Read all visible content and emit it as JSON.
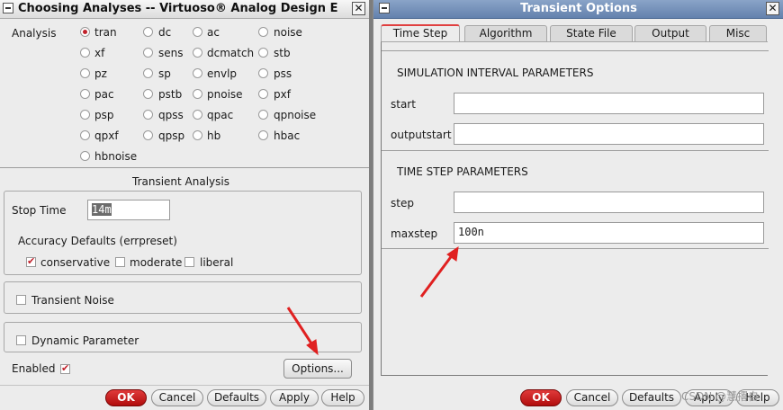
{
  "left_window": {
    "title": "Choosing Analyses -- Virtuoso® Analog Design E",
    "analysis_label": "Analysis",
    "analyses": [
      {
        "label": "tran",
        "selected": true
      },
      {
        "label": "dc",
        "selected": false
      },
      {
        "label": "ac",
        "selected": false
      },
      {
        "label": "noise",
        "selected": false
      },
      {
        "label": "xf",
        "selected": false
      },
      {
        "label": "sens",
        "selected": false
      },
      {
        "label": "dcmatch",
        "selected": false
      },
      {
        "label": "stb",
        "selected": false
      },
      {
        "label": "pz",
        "selected": false
      },
      {
        "label": "sp",
        "selected": false
      },
      {
        "label": "envlp",
        "selected": false
      },
      {
        "label": "pss",
        "selected": false
      },
      {
        "label": "pac",
        "selected": false
      },
      {
        "label": "pstb",
        "selected": false
      },
      {
        "label": "pnoise",
        "selected": false
      },
      {
        "label": "pxf",
        "selected": false
      },
      {
        "label": "psp",
        "selected": false
      },
      {
        "label": "qpss",
        "selected": false
      },
      {
        "label": "qpac",
        "selected": false
      },
      {
        "label": "qpnoise",
        "selected": false
      },
      {
        "label": "qpxf",
        "selected": false
      },
      {
        "label": "qpsp",
        "selected": false
      },
      {
        "label": "hb",
        "selected": false
      },
      {
        "label": "hbac",
        "selected": false
      },
      {
        "label": "hbnoise",
        "selected": false
      }
    ],
    "section_title": "Transient Analysis",
    "stop_time_label": "Stop Time",
    "stop_time_value": "14m",
    "accuracy_label": "Accuracy Defaults (errpreset)",
    "accuracy_options": [
      {
        "label": "conservative",
        "checked": true
      },
      {
        "label": "moderate",
        "checked": false
      },
      {
        "label": "liberal",
        "checked": false
      }
    ],
    "transient_noise_label": "Transient Noise",
    "dynamic_parameter_label": "Dynamic Parameter",
    "enabled_label": "Enabled",
    "enabled_checked": true,
    "options_button": "Options...",
    "buttons": {
      "ok": "OK",
      "cancel": "Cancel",
      "defaults": "Defaults",
      "apply": "Apply",
      "help": "Help"
    }
  },
  "right_window": {
    "title": "Transient Options",
    "tabs": [
      "Time Step",
      "Algorithm",
      "State File",
      "Output",
      "Misc"
    ],
    "active_tab": "Time Step",
    "sim_interval_heading": "SIMULATION INTERVAL PARAMETERS",
    "start_label": "start",
    "start_value": "",
    "outputstart_label": "outputstart",
    "outputstart_value": "",
    "time_step_heading": "TIME STEP PARAMETERS",
    "step_label": "step",
    "step_value": "",
    "maxstep_label": "maxstep",
    "maxstep_value": "100n",
    "buttons": {
      "ok": "OK",
      "cancel": "Cancel",
      "defaults": "Defaults",
      "apply": "Apply",
      "help": "Help"
    }
  },
  "watermark": "CSDN @慧撂自",
  "colors": {
    "accent_red": "#c0202a",
    "annotation_arrow": "#e02020",
    "titlebar_blue": "#6381ad"
  }
}
